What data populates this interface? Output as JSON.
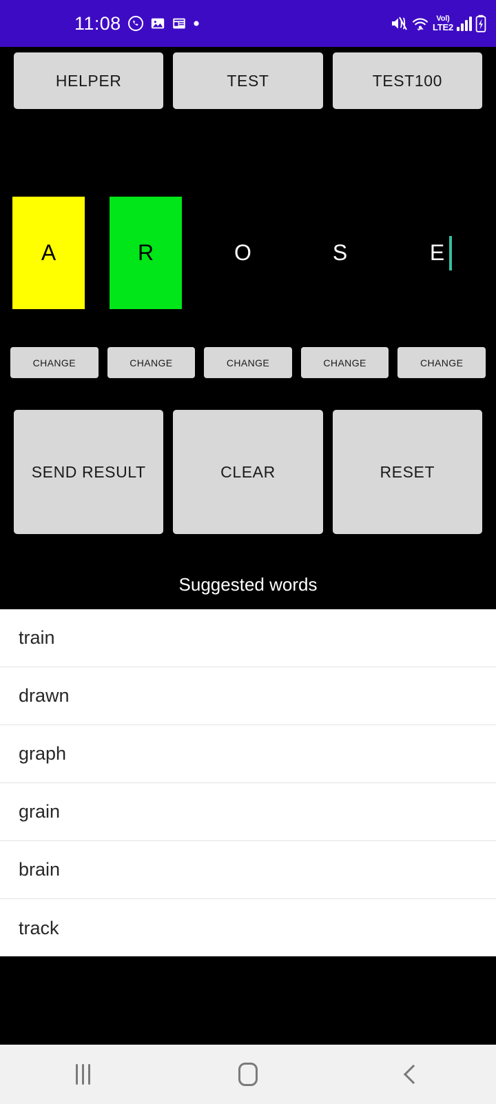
{
  "status_bar": {
    "background": "#3e0bc4",
    "time": "11:08",
    "left_icons": [
      "whatsapp-icon",
      "gallery-icon",
      "news-icon",
      "dot-icon"
    ],
    "right_icons": [
      "mute-icon",
      "wifi-icon",
      "volte-icon",
      "signal-icon",
      "battery-charging-icon"
    ],
    "volte_top": "Vol)",
    "volte_bottom": "LTE2"
  },
  "top_buttons": [
    {
      "label": "HELPER"
    },
    {
      "label": "TEST"
    },
    {
      "label": "TEST100"
    }
  ],
  "letter_slots": [
    {
      "letter": "A",
      "bg": "#ffff00",
      "fg": "#000000",
      "filled": true,
      "caret": false
    },
    {
      "letter": "R",
      "bg": "#00e619",
      "fg": "#000000",
      "filled": true,
      "caret": false
    },
    {
      "letter": "O",
      "bg": "#000000",
      "fg": "#ffffff",
      "filled": false,
      "caret": false
    },
    {
      "letter": "S",
      "bg": "#000000",
      "fg": "#ffffff",
      "filled": false,
      "caret": false
    },
    {
      "letter": "E",
      "bg": "#000000",
      "fg": "#ffffff",
      "filled": false,
      "caret": true
    }
  ],
  "caret_color": "#35bfa0",
  "change_buttons": [
    {
      "label": "CHANGE"
    },
    {
      "label": "CHANGE"
    },
    {
      "label": "CHANGE"
    },
    {
      "label": "CHANGE"
    },
    {
      "label": "CHANGE"
    }
  ],
  "action_buttons": [
    {
      "label": "SEND RESULT"
    },
    {
      "label": "CLEAR"
    },
    {
      "label": "RESET"
    }
  ],
  "suggested": {
    "title": "Suggested words",
    "words": [
      "train",
      "drawn",
      "graph",
      "grain",
      "brain",
      "track"
    ]
  },
  "nav_bar": {
    "background": "#f1f1f1",
    "items": [
      "recents-icon",
      "home-icon",
      "back-icon"
    ]
  }
}
